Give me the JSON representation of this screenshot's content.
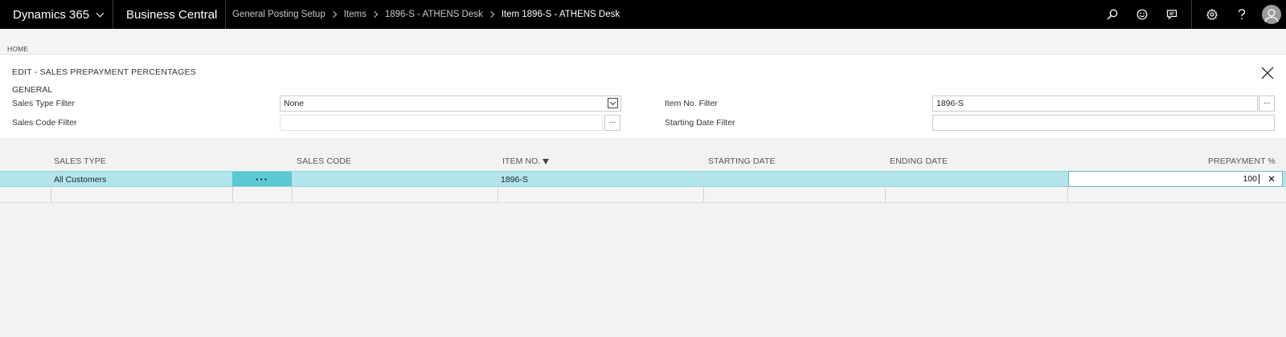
{
  "topbar": {
    "app_name": "Dynamics 365",
    "product_name": "Business Central",
    "breadcrumbs": [
      {
        "label": "General Posting Setup"
      },
      {
        "label": "Items"
      },
      {
        "label": "1896-S - ATHENS Desk"
      },
      {
        "label": "Item 1896-S - ATHENS Desk"
      }
    ],
    "icons": [
      "search-icon",
      "smiley-icon",
      "chat-icon",
      "gear-icon",
      "help-icon",
      "avatar"
    ]
  },
  "action_bar": {
    "home_tab": "HOME"
  },
  "page": {
    "title": "EDIT - SALES PREPAYMENT PERCENTAGES",
    "section_title": "GENERAL",
    "filters": {
      "sales_type_label": "Sales Type Filter",
      "sales_type_value": "None",
      "sales_code_label": "Sales Code Filter",
      "sales_code_value": "",
      "item_no_label": "Item No. Filter",
      "item_no_value": "1896-S",
      "starting_date_label": "Starting Date Filter",
      "starting_date_value": "",
      "lookup_label": "..."
    }
  },
  "grid": {
    "columns": {
      "sales_type": "SALES TYPE",
      "sales_code": "SALES CODE",
      "item_no": "ITEM NO.",
      "starting_date": "STARTING DATE",
      "ending_date": "ENDING DATE",
      "prepayment_pct": "PREPAYMENT %"
    },
    "rows": [
      {
        "sales_type": "All Customers",
        "row_action": "···",
        "sales_code": "",
        "item_no": "1896-S",
        "starting_date": "",
        "ending_date": "",
        "prepayment_pct": "100",
        "clear": "✕"
      }
    ]
  },
  "colors": {
    "topbar_bg": "#000000",
    "selected_row": "#b0e5eb",
    "row_action": "#5bc8d2"
  }
}
